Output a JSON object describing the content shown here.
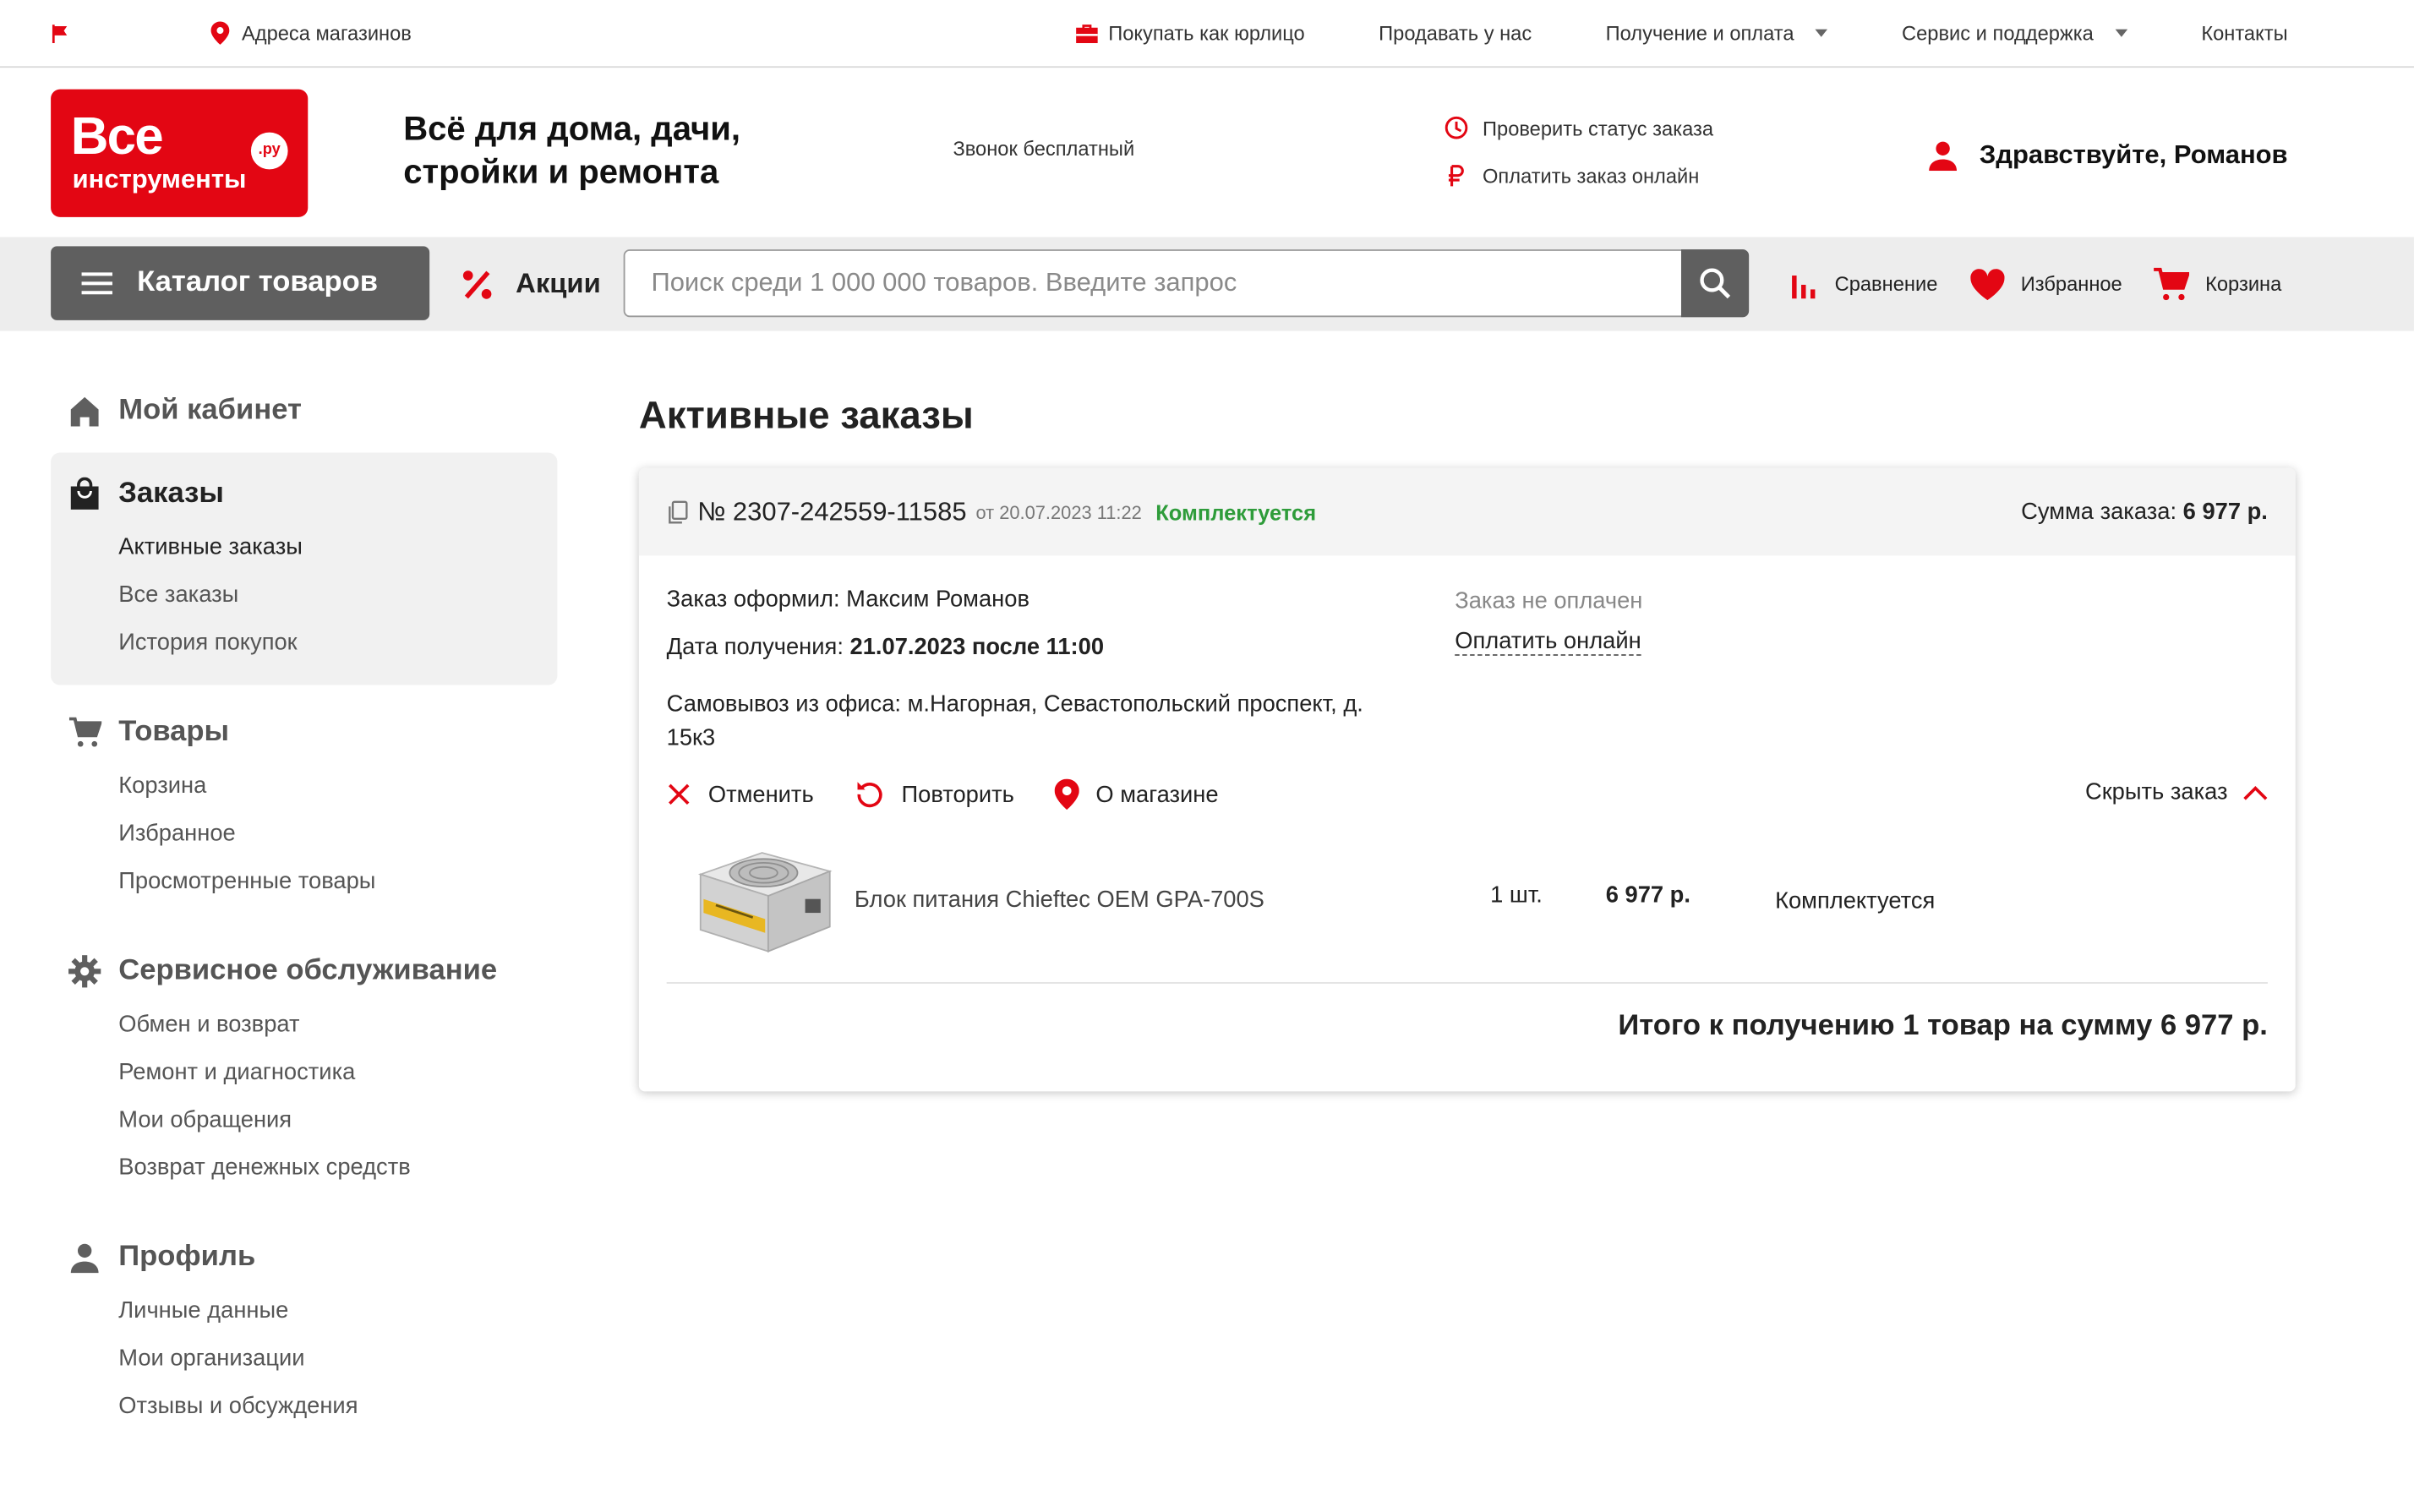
{
  "topbar": {
    "store_addresses": "Адреса магазинов",
    "links": [
      {
        "label": "Покупать как юрлицо"
      },
      {
        "label": "Продавать у нас"
      },
      {
        "label": "Получение и оплата"
      },
      {
        "label": "Сервис и поддержка"
      },
      {
        "label": "Контакты"
      }
    ]
  },
  "header": {
    "logo": {
      "line1": "Все",
      "line2": "инструменты",
      "badge": ".ру"
    },
    "slogan_line1": "Всё для дома, дачи,",
    "slogan_line2": "стройки и ремонта",
    "call_free": "Звонок бесплатный",
    "check_status": "Проверить статус заказа",
    "pay_online": "Оплатить заказ онлайн",
    "greeting": "Здравствуйте, Романов"
  },
  "navbar": {
    "catalog": "Каталог товаров",
    "promo": "Акции",
    "search_placeholder": "Поиск среди 1 000 000 товаров. Введите запрос",
    "compare": "Сравнение",
    "favorites": "Избранное",
    "cart": "Корзина"
  },
  "sidebar": {
    "cabinet": "Мой кабинет",
    "orders": {
      "title": "Заказы",
      "items": [
        "Активные заказы",
        "Все заказы",
        "История покупок"
      ]
    },
    "goods": {
      "title": "Товары",
      "items": [
        "Корзина",
        "Избранное",
        "Просмотренные товары"
      ]
    },
    "service": {
      "title": "Сервисное обслуживание",
      "items": [
        "Обмен и возврат",
        "Ремонт и диагностика",
        "Мои обращения",
        "Возврат денежных средств"
      ]
    },
    "profile": {
      "title": "Профиль",
      "items": [
        "Личные данные",
        "Мои организации",
        "Отзывы и обсуждения"
      ]
    }
  },
  "main": {
    "title": "Активные заказы",
    "order": {
      "number": "№ 2307-242559-11585",
      "date": "от 20.07.2023 11:22",
      "status": "Комплектуется",
      "sum_label": "Сумма заказа:",
      "sum_value": "6 977 р.",
      "placed_by": "Заказ оформил: Максим Романов",
      "receive_label": "Дата получения:",
      "receive_value": "21.07.2023 после 11:00",
      "pickup_line1": "Самовывоз из офиса: м.Нагорная, Севастопольский проспект, д.",
      "pickup_line2": "15к3",
      "payment_state": "Заказ не оплачен",
      "pay_link": "Оплатить онлайн",
      "actions": {
        "cancel": "Отменить",
        "repeat": "Повторить",
        "store": "О магазине"
      },
      "hide": "Скрыть заказ",
      "product": {
        "name": "Блок питания Chieftec OEM GPA-700S",
        "qty": "1 шт.",
        "price": "6 977 р.",
        "status": "Комплектуется"
      },
      "total": "Итого к получению 1 товар на сумму 6 977 р."
    }
  },
  "colors": {
    "brand_red": "#e30613",
    "status_green": "#2e9c3a",
    "nav_gray": "#5f5f5f"
  }
}
